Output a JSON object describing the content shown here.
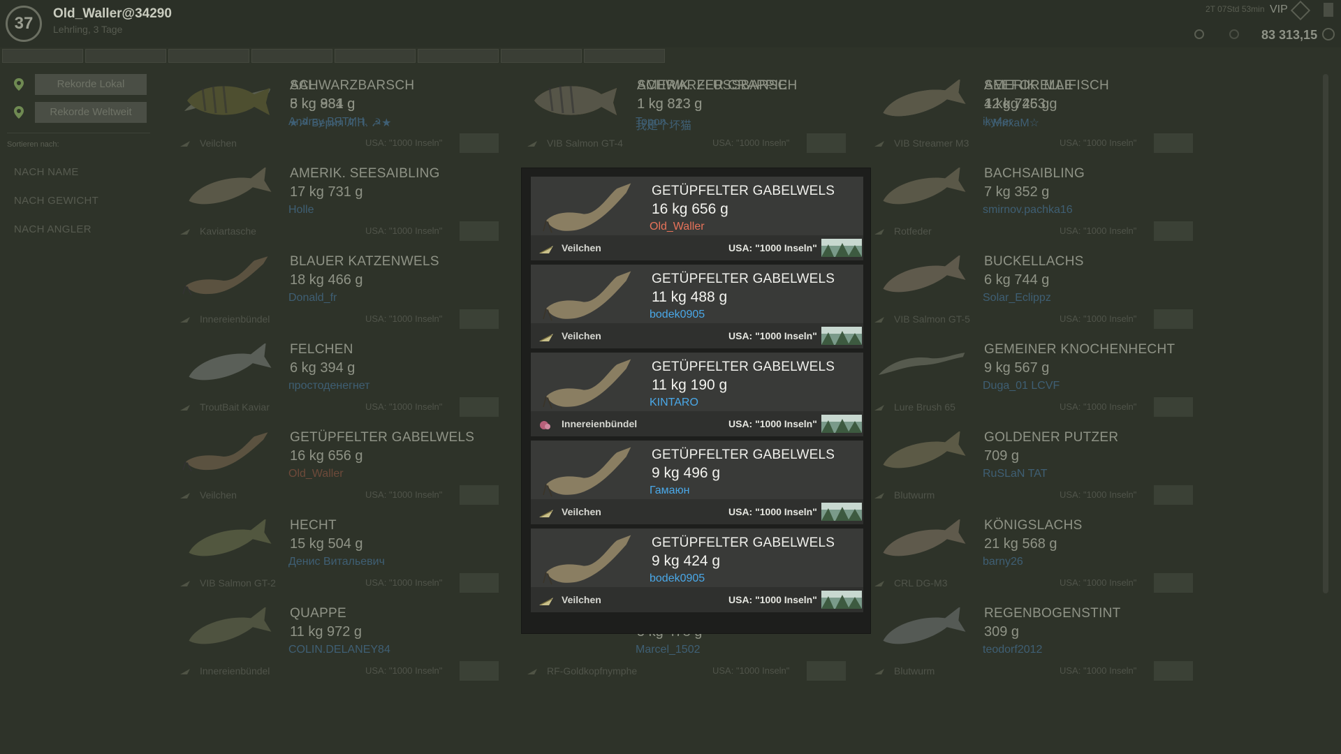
{
  "player": {
    "level": "37",
    "name": "Old_Waller@34290",
    "sub": "Lehrling, 3 Tage",
    "vip_time": "2T 07Std 53min",
    "vip_label": "VIP",
    "money": "83 313,15"
  },
  "nav_tabs": [
    "",
    "",
    "",
    "",
    "",
    "",
    "",
    ""
  ],
  "sidebar": {
    "btn_local": "Rekorde Lokal",
    "btn_world": "Rekorde Weltweit",
    "sort_label": "Sortieren nach:",
    "sort_items": [
      "NACH NAME",
      "NACH GEWICHT",
      "NACH ANGLER"
    ]
  },
  "records": [
    {
      "name": "AAL",
      "weight": "8 kg 831 g",
      "angler": "★☭ Берия Л.П. ☭★",
      "bait": "Veilchen",
      "loc": "USA: \"1000 Inseln\"",
      "angler_color": "#3f5f74",
      "fish": "eel"
    },
    {
      "name": "AMERIK. FLUSSBARSCH",
      "weight": "1 kg 813 g",
      "angler": "我是个坏猫",
      "bait": "VIB Salmon GT-4",
      "loc": "USA: \"1000 Inseln\"",
      "angler_color": "#3f5f74",
      "fish": "perch"
    },
    {
      "name": "AMERIK. MAIFISCH",
      "weight": "4 kg 725 g",
      "angler": "☆МихаМ☆",
      "bait": "VIB Streamer M3",
      "loc": "USA: \"1000 Inseln\"",
      "angler_color": "#3f5f74",
      "fish": "shad"
    },
    {
      "name": "AMERIK. SEESAIBLING",
      "weight": "17 kg 731 g",
      "angler": "Holle",
      "bait": "Kaviartasche",
      "loc": "USA: \"1000 Inseln\"",
      "angler_color": "#3f5f74",
      "fish": "trout"
    },
    {
      "name": "",
      "weight": "",
      "angler": "",
      "bait": "",
      "loc": "",
      "angler_color": "#3f5f74",
      "fish": "none"
    },
    {
      "name": "BACHSAIBLING",
      "weight": "7 kg 352 g",
      "angler": "smirnov.pachka16",
      "bait": "Rotfeder",
      "loc": "USA: \"1000 Inseln\"",
      "angler_color": "#3f5f74",
      "fish": "trout"
    },
    {
      "name": "BLAUER KATZENWELS",
      "weight": "18 kg 466 g",
      "angler": "Donald_fr",
      "bait": "Innereienbündel",
      "loc": "USA: \"1000 Inseln\"",
      "angler_color": "#3f5f74",
      "fish": "catfish"
    },
    {
      "name": "",
      "weight": "",
      "angler": "",
      "bait": "",
      "loc": "",
      "angler_color": "#3f5f74",
      "fish": "none"
    },
    {
      "name": "BUCKELLACHS",
      "weight": "6 kg 744 g",
      "angler": "Solar_Eclippz",
      "bait": "VIB Salmon GT-5",
      "loc": "USA: \"1000 Inseln\"",
      "angler_color": "#3f5f74",
      "fish": "salmon"
    },
    {
      "name": "FELCHEN",
      "weight": "6 kg 394 g",
      "angler": "простоденегнет",
      "bait": "TroutBait Kaviar",
      "loc": "USA: \"1000 Inseln\"",
      "angler_color": "#3f5f74",
      "fish": "whitefish"
    },
    {
      "name": "",
      "weight": "",
      "angler": "",
      "bait": "",
      "loc": "",
      "angler_color": "#3f5f74",
      "fish": "none"
    },
    {
      "name": "GEMEINER KNOCHENHECHT",
      "weight": "9 kg 567 g",
      "angler": "Duga_01 LCVF",
      "bait": "Lure Brush 65",
      "loc": "USA: \"1000 Inseln\"",
      "angler_color": "#3f5f74",
      "fish": "gar"
    },
    {
      "name": "GETÜPFELTER GABELWELS",
      "weight": "16 kg 656 g",
      "angler": "Old_Waller",
      "bait": "Veilchen",
      "loc": "USA: \"1000 Inseln\"",
      "angler_color": "#6e4a3a",
      "fish": "catfish"
    },
    {
      "name": "",
      "weight": "",
      "angler": "",
      "bait": "",
      "loc": "",
      "angler_color": "#3f5f74",
      "fish": "none"
    },
    {
      "name": "GOLDENER PUTZER",
      "weight": "709 g",
      "angler": "RuSLaN TAT",
      "bait": "Blutwurm",
      "loc": "USA: \"1000 Inseln\"",
      "angler_color": "#3f5f74",
      "fish": "shiner"
    },
    {
      "name": "HECHT",
      "weight": "15 kg 504 g",
      "angler": "Денис Витальевич",
      "bait": "VIB Salmon GT-2",
      "loc": "USA: \"1000 Inseln\"",
      "angler_color": "#3f5f74",
      "fish": "pike"
    },
    {
      "name": "",
      "weight": "",
      "angler": "",
      "bait": "",
      "loc": "",
      "angler_color": "#3f5f74",
      "fish": "none"
    },
    {
      "name": "KÖNIGSLACHS",
      "weight": "21 kg 568 g",
      "angler": "barny26",
      "bait": "CRL DG-M3",
      "loc": "USA: \"1000 Inseln\"",
      "angler_color": "#3f5f74",
      "fish": "salmon"
    },
    {
      "name": "QUAPPE",
      "weight": "11 kg 972 g",
      "angler": "COLIN.DELANEY84",
      "bait": "Innereienbündel",
      "loc": "USA: \"1000 Inseln\"",
      "angler_color": "#3f5f74",
      "fish": "burbot"
    },
    {
      "name": "",
      "weight": "5 kg 478 g",
      "angler": "Marcel_1502",
      "bait": "RF-Goldkopfnymphe",
      "loc": "USA: \"1000 Inseln\"",
      "angler_color": "#3f5f74",
      "fish": "none"
    },
    {
      "name": "REGENBOGENSTINT",
      "weight": "309 g",
      "angler": "teodorf2012",
      "bait": "Blutwurm",
      "loc": "USA: \"1000 Inseln\"",
      "angler_color": "#3f5f74",
      "fish": "smelt"
    },
    {
      "name": "SCHWARZBARSCH",
      "weight": "5 kg 984 g",
      "angler": "Andrey ВЯТИЧ.",
      "bait": "",
      "loc": "",
      "angler_color": "#3f5f74",
      "fish": "bass"
    },
    {
      "name": "SCHWARZER CRAPPIE",
      "weight": "1 kg 823 g",
      "angler": "Topon",
      "bait": "",
      "loc": "",
      "angler_color": "#3f5f74",
      "fish": "crappie"
    },
    {
      "name": "SEEFORELLE",
      "weight": "12 kg 463 g",
      "angler": "iky4er",
      "bait": "",
      "loc": "",
      "angler_color": "#3f5f74",
      "fish": "trout"
    }
  ],
  "popup": {
    "entries": [
      {
        "name": "GETÜPFELTER GABELWELS",
        "weight": "16 kg 656 g",
        "angler": "Old_Waller",
        "angler_color": "#e8735a",
        "bait": "Veilchen",
        "bait_icon": "lure-icon",
        "loc": "USA: \"1000 Inseln\""
      },
      {
        "name": "GETÜPFELTER GABELWELS",
        "weight": "11 kg 488 g",
        "angler": "bodek0905",
        "angler_color": "#4aa8e8",
        "bait": "Veilchen",
        "bait_icon": "lure-icon",
        "loc": "USA: \"1000 Inseln\""
      },
      {
        "name": "GETÜPFELTER GABELWELS",
        "weight": "11 kg 190 g",
        "angler": "KINTARO",
        "angler_color": "#4aa8e8",
        "bait": "Innereienbündel",
        "bait_icon": "guts-icon",
        "loc": "USA: \"1000 Inseln\""
      },
      {
        "name": "GETÜPFELTER GABELWELS",
        "weight": "9 kg 496 g",
        "angler": "Гамаюн",
        "angler_color": "#4aa8e8",
        "bait": "Veilchen",
        "bait_icon": "lure-icon",
        "loc": "USA: \"1000 Inseln\""
      },
      {
        "name": "GETÜPFELTER GABELWELS",
        "weight": "9 kg 424 g",
        "angler": "bodek0905",
        "angler_color": "#4aa8e8",
        "bait": "Veilchen",
        "bait_icon": "lure-icon",
        "loc": "USA: \"1000 Inseln\""
      }
    ]
  }
}
